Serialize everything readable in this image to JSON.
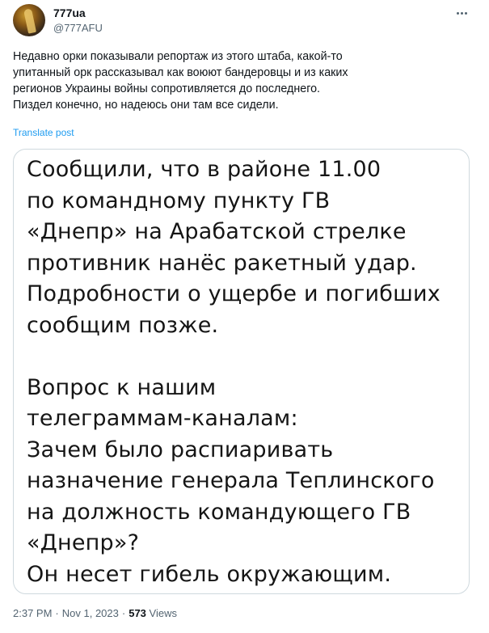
{
  "author": {
    "display_name": "777ua",
    "handle": "@777AFU"
  },
  "post": {
    "text_lines": [
      "Недавно орки показывали репортаж из этого штаба, какой-то",
      "упитанный орк рассказывал как воюют бандеровцы и из каких",
      "регионов Украины войны сопротивляется до последнего.",
      "Пиздел конечно, но надеюсь они там все сидели."
    ],
    "translate_label": "Translate post"
  },
  "media": {
    "text_lines": [
      "Сообщили, что в районе 11.00",
      "по командному пункту ГВ",
      "«Днепр» на Арабатской стрелке",
      "противник нанёс ракетный удар.",
      "Подробности о ущербе и погибших",
      "сообщим позже.",
      "",
      "Вопрос к нашим",
      "телеграммам-каналам:",
      "Зачем было распиаривать",
      "назначение генерала Теплинского",
      "на должность командующего ГВ",
      "«Днепр»?",
      "Он несет гибель окружающим."
    ]
  },
  "meta": {
    "time": "2:37 PM",
    "date": "Nov 1, 2023",
    "separator": "·",
    "views_count": "573",
    "views_label": "Views"
  },
  "icons": {
    "more": "more-horizontal-icon"
  },
  "colors": {
    "link": "#1d9bf0",
    "secondary_text": "#536471",
    "primary_text": "#0f1419",
    "border": "#cfd9de"
  }
}
